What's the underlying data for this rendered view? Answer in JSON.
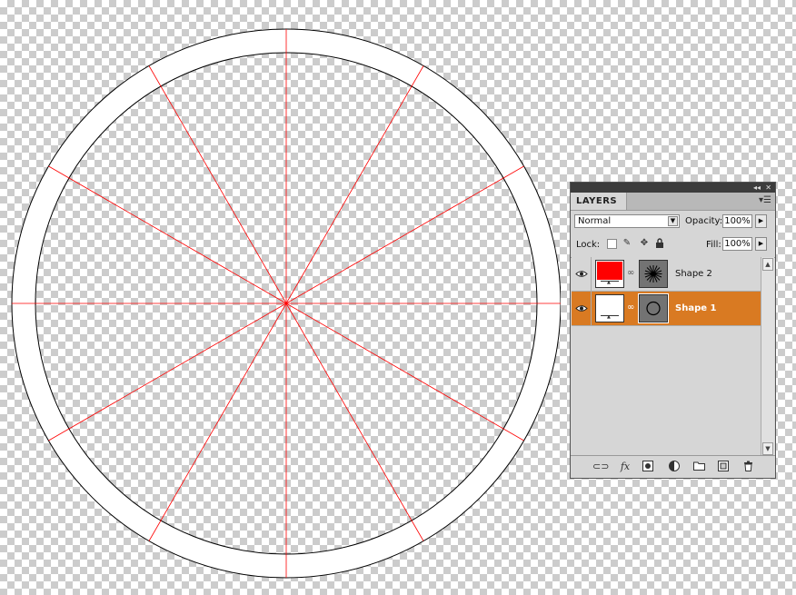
{
  "canvas": {
    "background": "transparent-checkerboard",
    "ring_color": "#ffffff",
    "guide_color": "#ff0000",
    "spoke_count": 12
  },
  "layers_panel": {
    "tab_label": "LAYERS",
    "blend_mode": "Normal",
    "opacity_label": "Opacity:",
    "opacity_value": "100%",
    "lock_label": "Lock:",
    "fill_label": "Fill:",
    "fill_value": "100%",
    "layers": [
      {
        "name": "Shape 2",
        "color": "#ff0000",
        "mask": "starburst",
        "selected": false,
        "visible": true
      },
      {
        "name": "Shape 1",
        "color": "#ffffff",
        "mask": "circle",
        "selected": true,
        "visible": true
      }
    ],
    "selection_color": "#d97a22",
    "footer_icons": [
      "link-layers-icon",
      "fx-icon",
      "add-mask-icon",
      "adjustment-layer-icon",
      "new-group-icon",
      "new-layer-icon",
      "trash-icon"
    ]
  }
}
